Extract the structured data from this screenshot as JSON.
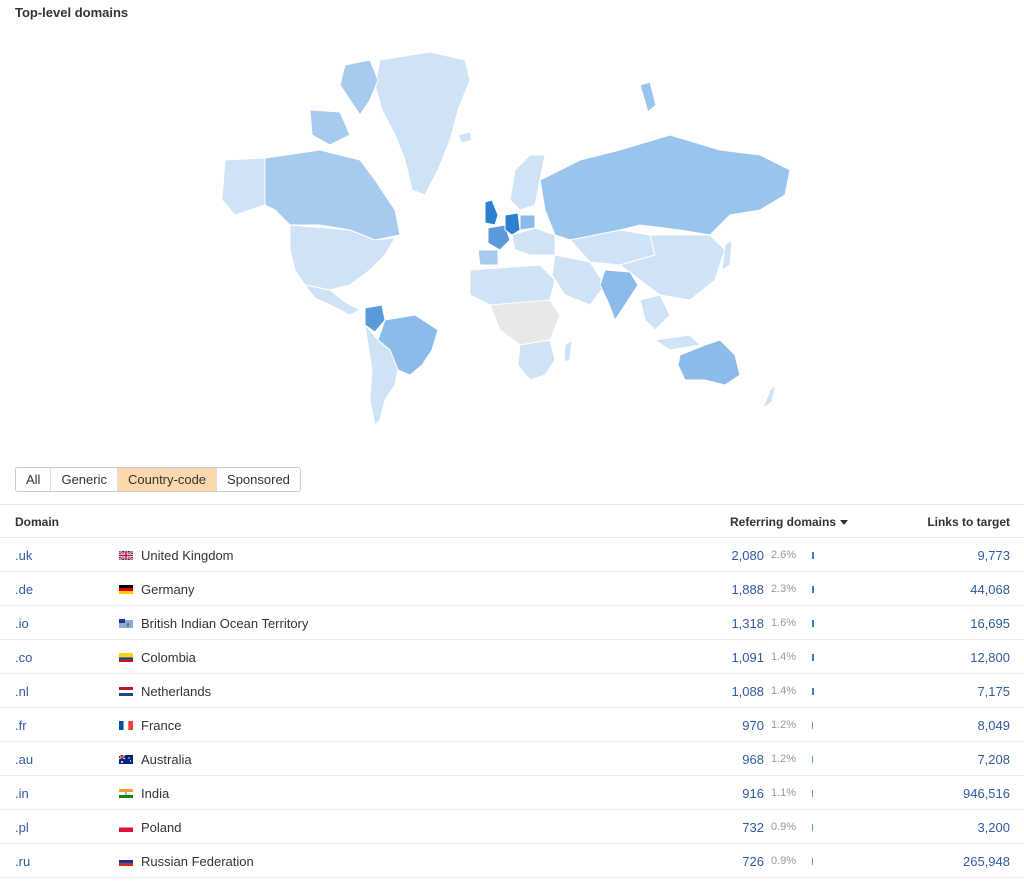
{
  "title": "Top-level domains",
  "map": {
    "colors": {
      "highest": "#2e80cf",
      "high": "#5a9ad8",
      "mid": "#8dbbe9",
      "midlow": "#a6cbee",
      "low": "#cfe2f6",
      "none": "#e8e8e8"
    }
  },
  "filters": {
    "options": [
      "All",
      "Generic",
      "Country-code",
      "Sponsored"
    ],
    "active": "Country-code"
  },
  "table": {
    "columns": {
      "domain": "Domain",
      "referring_domains": "Referring domains",
      "links_to_target": "Links to target"
    },
    "sort": {
      "column": "Referring domains",
      "direction": "desc"
    },
    "rows": [
      {
        "tld": ".uk",
        "flag": "gb-flag",
        "country": "United Kingdom",
        "referring_domains": "2,080",
        "percent": "2.6%",
        "share": 0.026,
        "links": "9,773"
      },
      {
        "tld": ".de",
        "flag": "de-flag",
        "country": "Germany",
        "referring_domains": "1,888",
        "percent": "2.3%",
        "share": 0.023,
        "links": "44,068"
      },
      {
        "tld": ".io",
        "flag": "io-flag",
        "country": "British Indian Ocean Territory",
        "referring_domains": "1,318",
        "percent": "1.6%",
        "share": 0.016,
        "links": "16,695"
      },
      {
        "tld": ".co",
        "flag": "co-flag",
        "country": "Colombia",
        "referring_domains": "1,091",
        "percent": "1.4%",
        "share": 0.014,
        "links": "12,800"
      },
      {
        "tld": ".nl",
        "flag": "nl-flag",
        "country": "Netherlands",
        "referring_domains": "1,088",
        "percent": "1.4%",
        "share": 0.014,
        "links": "7,175"
      },
      {
        "tld": ".fr",
        "flag": "fr-flag",
        "country": "France",
        "referring_domains": "970",
        "percent": "1.2%",
        "share": 0.012,
        "links": "8,049"
      },
      {
        "tld": ".au",
        "flag": "au-flag",
        "country": "Australia",
        "referring_domains": "968",
        "percent": "1.2%",
        "share": 0.012,
        "links": "7,208"
      },
      {
        "tld": ".in",
        "flag": "in-flag",
        "country": "India",
        "referring_domains": "916",
        "percent": "1.1%",
        "share": 0.011,
        "links": "946,516"
      },
      {
        "tld": ".pl",
        "flag": "pl-flag",
        "country": "Poland",
        "referring_domains": "732",
        "percent": "0.9%",
        "share": 0.009,
        "links": "3,200"
      },
      {
        "tld": ".ru",
        "flag": "ru-flag",
        "country": "Russian Federation",
        "referring_domains": "726",
        "percent": "0.9%",
        "share": 0.009,
        "links": "265,948"
      }
    ]
  }
}
